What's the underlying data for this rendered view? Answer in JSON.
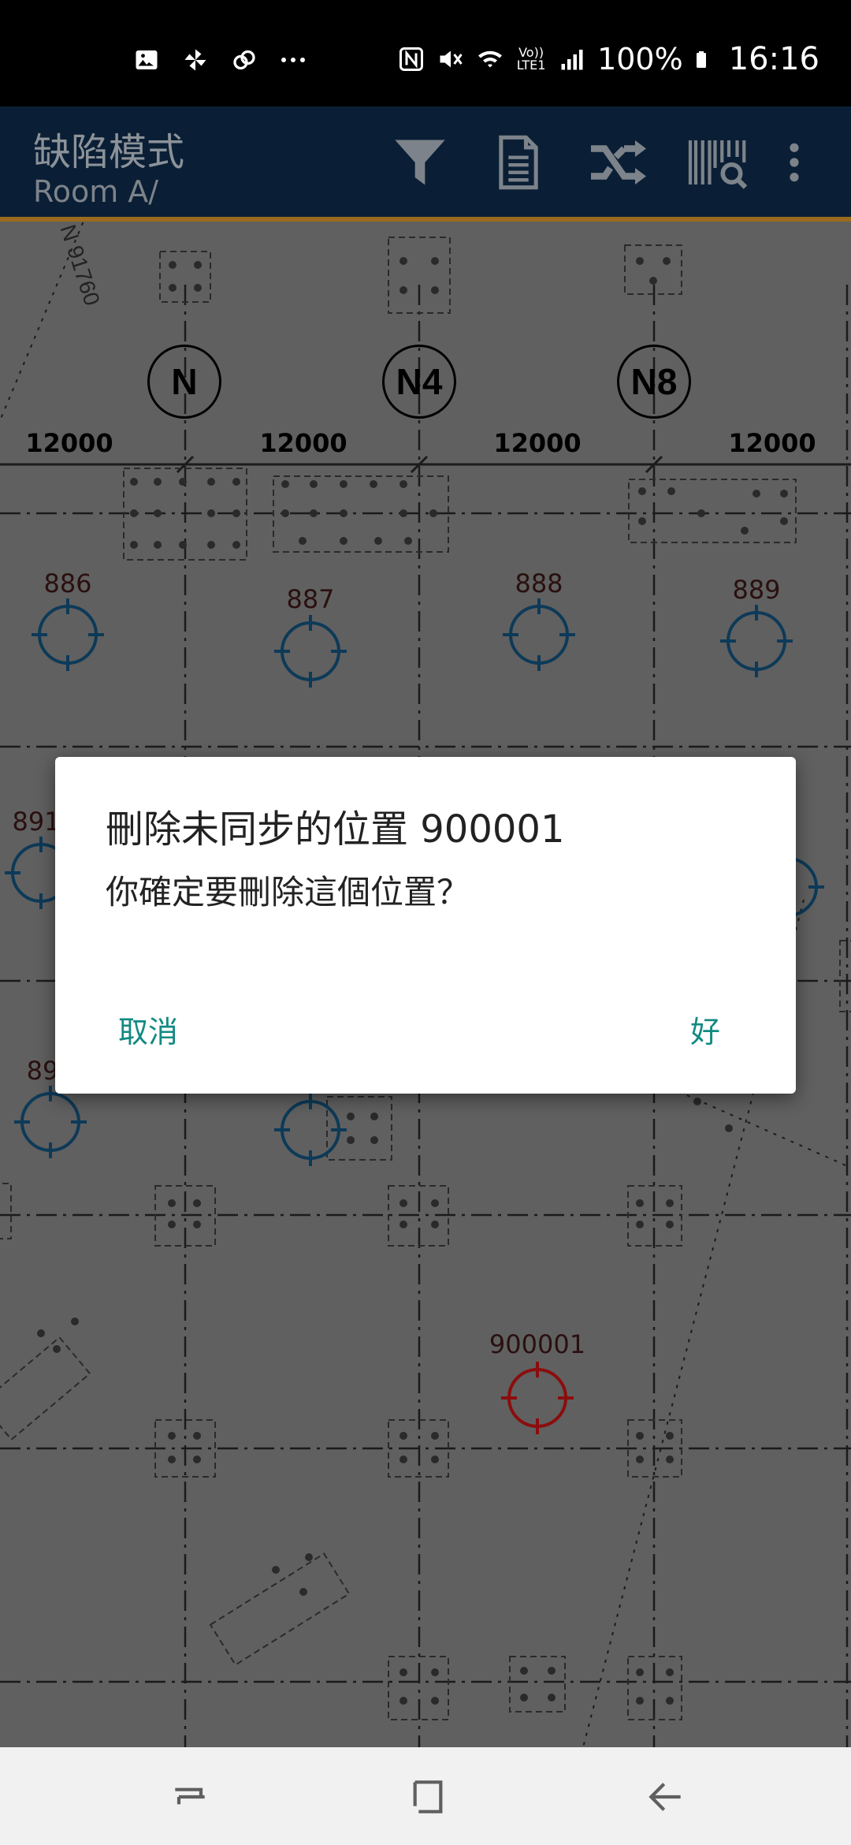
{
  "status_bar": {
    "battery": "100%",
    "time": "16:16",
    "icons": [
      "image-icon",
      "pinwheel-icon",
      "link-icon",
      "more-dots-icon",
      "nfc-icon",
      "mute-icon",
      "wifi-icon",
      "volte-icon",
      "signal-icon",
      "battery-icon"
    ],
    "volte_text": "Vo)) LTE1"
  },
  "app_bar": {
    "title": "缺陷模式",
    "subtitle": "Room A/",
    "actions": [
      "filter-icon",
      "document-icon",
      "shuffle-icon",
      "barcode-search-icon",
      "overflow-menu-icon"
    ]
  },
  "plan": {
    "scale_note": "N 91760",
    "axes": [
      {
        "label": "N"
      },
      {
        "label": "N4"
      },
      {
        "label": "N8"
      }
    ],
    "spans": [
      "12000",
      "12000",
      "12000",
      "12000"
    ],
    "locations": [
      {
        "id": "886",
        "status": "synced"
      },
      {
        "id": "887",
        "status": "synced"
      },
      {
        "id": "888",
        "status": "synced"
      },
      {
        "id": "889",
        "status": "synced"
      },
      {
        "id": "891",
        "status": "synced"
      },
      {
        "id": "89",
        "status": "synced"
      },
      {
        "id": "900001",
        "status": "unsynced"
      }
    ],
    "colors": {
      "marker_synced": "#0d3a58",
      "marker_unsynced": "#8b0d0d",
      "plan_bg": "#606060"
    }
  },
  "dialog": {
    "title": "刪除未同步的位置 900001",
    "message": "你確定要刪除這個位置？",
    "cancel_label": "取消",
    "ok_label": "好",
    "accent": "#128a83"
  },
  "nav_bar": {
    "buttons": [
      "recent-apps-icon",
      "home-icon",
      "back-icon"
    ]
  }
}
